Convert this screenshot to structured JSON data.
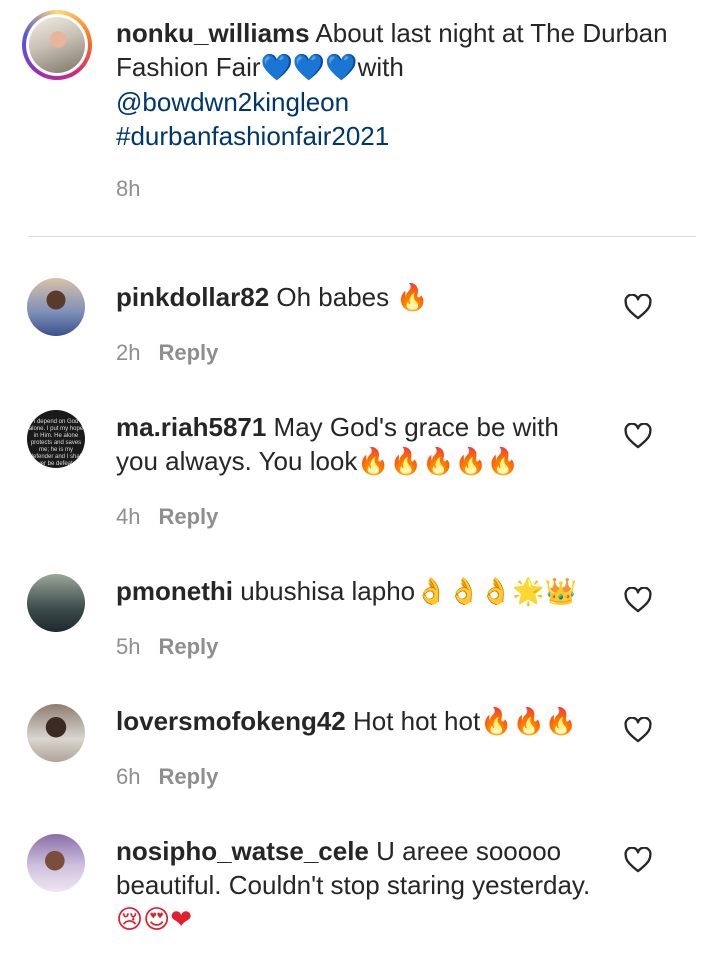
{
  "caption": {
    "username": "nonku_williams",
    "text_a": " About last night at The Durban Fashion Fair",
    "emoji_hearts": "💙💙💙",
    "text_b": "with",
    "mention": "@bowdwn2kingleon",
    "hashtag": "#durbanfashionfair2021",
    "time": "8h"
  },
  "reply_label": "Reply",
  "comments": [
    {
      "username": "pinkdollar82",
      "text": " Oh babes ",
      "emoji": "🔥",
      "time": "2h"
    },
    {
      "username": "ma.riah5871",
      "text": " May God's grace be with you always. You look",
      "emoji": "🔥🔥🔥🔥🔥",
      "time": "4h",
      "avatar_text": "I depend on God alone. I put my hope in Him. He alone protects and saves me; he is my defender and I shall never be defeated."
    },
    {
      "username": "pmonethi",
      "text": " ubushisa lapho",
      "emoji": "👌👌👌🌟👑",
      "time": "5h"
    },
    {
      "username": "loversmofokeng42",
      "text": " Hot hot hot",
      "emoji": "🔥🔥🔥",
      "time": "6h"
    },
    {
      "username": "nosipho_watse_cele",
      "text": " U areee sooooo beautiful. Couldn't stop staring yesterday.",
      "emoji": "😢😍❤",
      "time": ""
    }
  ],
  "icons": {
    "like": "heart-outline-icon"
  },
  "colors": {
    "link": "#00376b",
    "muted": "#8e8e8e",
    "text": "#262626"
  }
}
